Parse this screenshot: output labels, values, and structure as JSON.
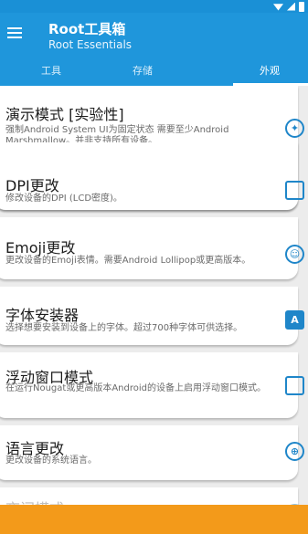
{
  "appbar": {
    "title": "Root工具箱",
    "subtitle": "Root Essentials"
  },
  "tabs": [
    {
      "label": "工具"
    },
    {
      "label": "存储"
    },
    {
      "label": "外观"
    }
  ],
  "cards": [
    {
      "title": "演示模式 [实验性]",
      "desc": "强制Android System UI为固定状态 需要至少Android Marshmallow。并非支持所有设备。",
      "icon": "demo-mode-icon"
    },
    {
      "title": "DPI更改",
      "desc": "修改设备的DPI (LCD密度)。",
      "icon": "dpi-screen-icon"
    },
    {
      "title": "Emoji更改",
      "desc": "更改设备的Emoji表情。需要Android Lollipop或更高版本。",
      "icon": "emoji-smile-icon"
    },
    {
      "title": "字体安装器",
      "desc": "选择想要安装到设备上的字体。超过700种字体可供选择。",
      "icon": "font-icon"
    },
    {
      "title": "浮动窗口模式",
      "desc": "在运行Nougat或更高版本Android的设备上启用浮动窗口模式。",
      "icon": "floating-window-icon"
    },
    {
      "title": "语言更改",
      "desc": "更改设备的系统语言。",
      "icon": "globe-icon"
    },
    {
      "title": "夜间模式",
      "desc": "",
      "icon": "night-mode-icon"
    }
  ],
  "colors": {
    "primary": "#1f96db",
    "accent": "#f39a1a",
    "icon": "#1f86c9"
  }
}
